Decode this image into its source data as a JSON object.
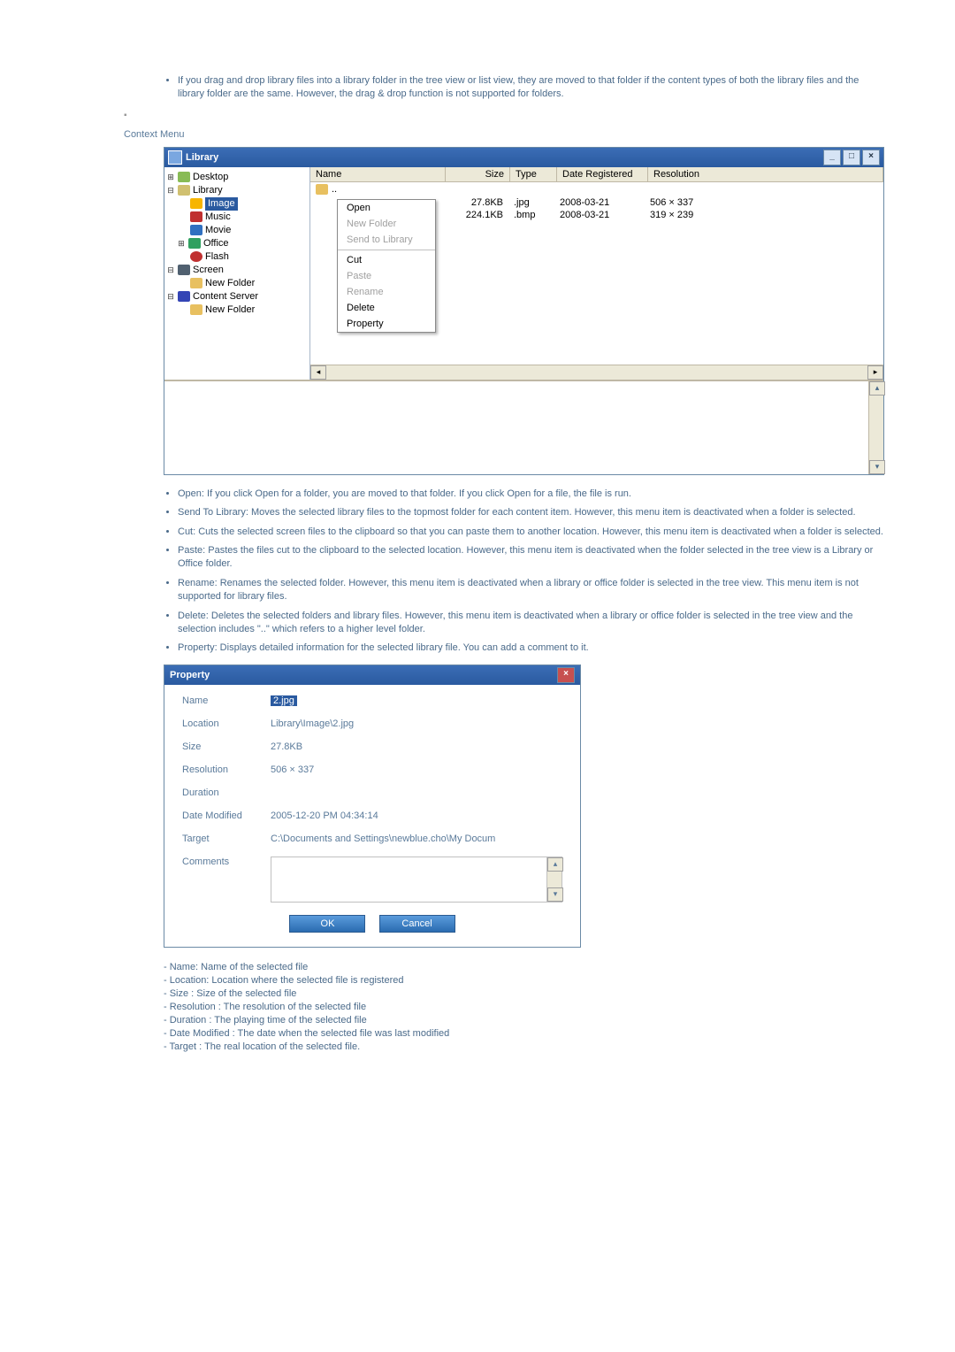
{
  "intro": "If you drag and drop library files into a library folder in the tree view or list view, they are moved to that folder if the content types of both the library files and the library folder are the same. However, the drag & drop function is not supported for folders.",
  "sectionLabel": "Context Menu",
  "libraryWindow": {
    "title": "Library",
    "tree": {
      "desktop": "Desktop",
      "library": "Library",
      "image": "Image",
      "music": "Music",
      "movie": "Movie",
      "office": "Office",
      "flash": "Flash",
      "screen": "Screen",
      "newFolder1": "New Folder",
      "contentServer": "Content Server",
      "newFolder2": "New Folder"
    },
    "columns": {
      "name": "Name",
      "size": "Size",
      "type": "Type",
      "date": "Date Registered",
      "resolution": "Resolution"
    },
    "upFolder": "..",
    "rows": [
      {
        "size": "27.8KB",
        "type": ".jpg",
        "date": "2008-03-21",
        "res": "506 × 337"
      },
      {
        "size": "224.1KB",
        "type": ".bmp",
        "date": "2008-03-21",
        "res": "319 × 239"
      }
    ],
    "contextMenu": {
      "open": "Open",
      "newFolder": "New Folder",
      "sendToLibrary": "Send to Library",
      "cut": "Cut",
      "paste": "Paste",
      "rename": "Rename",
      "delete": "Delete",
      "property": "Property"
    }
  },
  "descriptions": {
    "open": "Open: If you click Open for a folder, you are moved to that folder. If you click Open for a file, the file is run.",
    "sendToLibrary": "Send To Library: Moves the selected library files to the topmost folder for each content item. However, this menu item is deactivated when a folder is selected.",
    "cut": "Cut: Cuts the selected screen files to the clipboard so that you can paste them to another location. However, this menu item is deactivated when a folder is selected.",
    "paste": "Paste: Pastes the files cut to the clipboard to the selected location. However, this menu item is deactivated when the folder selected in the tree view is a Library or Office folder.",
    "rename": "Rename: Renames the selected folder. However, this menu item is deactivated when a library or office folder is selected in the tree view. This menu item is not supported for library files.",
    "delete": "Delete: Deletes the selected folders and library files. However, this menu item is deactivated when a library or office folder is selected in the tree view and the selection includes \"..\" which refers to a higher level folder.",
    "property": "Property: Displays detailed information for the selected library file. You can add a comment to it."
  },
  "propertyDialog": {
    "title": "Property",
    "labels": {
      "name": "Name",
      "location": "Location",
      "size": "Size",
      "resolution": "Resolution",
      "duration": "Duration",
      "dateModified": "Date Modified",
      "target": "Target",
      "comments": "Comments"
    },
    "values": {
      "name": "2.jpg",
      "location": "Library\\Image\\2.jpg",
      "size": "27.8KB",
      "resolution": "506 × 337",
      "duration": "",
      "dateModified": "2005-12-20 PM 04:34:14",
      "target": "C:\\Documents and Settings\\newblue.cho\\My Docum"
    },
    "buttons": {
      "ok": "OK",
      "cancel": "Cancel"
    }
  },
  "footerList": {
    "name": "- Name: Name of the selected file",
    "location": "- Location: Location where the selected file is registered",
    "size": "- Size : Size of the selected file",
    "resolution": "- Resolution : The resolution of the selected file",
    "duration": "- Duration : The playing time of the selected file",
    "dateModified": "- Date Modified : The date when the selected file was last modified",
    "target": "- Target : The real location of the selected file."
  }
}
